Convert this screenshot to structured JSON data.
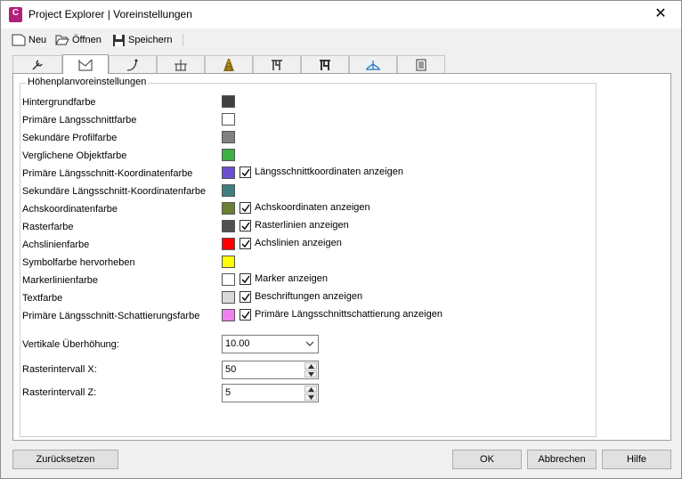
{
  "window": {
    "title": "Project Explorer | Voreinstellungen",
    "app_icon_letter": "C",
    "close_glyph": "✕"
  },
  "toolbar": {
    "new_label": "Neu",
    "open_label": "Öffnen",
    "save_label": "Speichern"
  },
  "tabs": [
    {
      "icon": "wrench-icon",
      "active": false
    },
    {
      "icon": "profile-view-icon",
      "active": true
    },
    {
      "icon": "alignment-curve-icon",
      "active": false
    },
    {
      "icon": "bridge-icon",
      "active": false
    },
    {
      "icon": "road-icon",
      "active": false
    },
    {
      "icon": "pipe-network-icon",
      "active": false
    },
    {
      "icon": "pressure-pipe-icon",
      "active": false
    },
    {
      "icon": "cross-section-icon",
      "active": false
    },
    {
      "icon": "table-icon",
      "active": false
    }
  ],
  "group": {
    "title": "Höhenplanvoreinstellungen"
  },
  "colors": [
    {
      "label": "Hintergrundfarbe",
      "color": "#404040"
    },
    {
      "label": "Primäre Längsschnittfarbe",
      "color": "#ffffff"
    },
    {
      "label": "Sekundäre Profilfarbe",
      "color": "#808080"
    },
    {
      "label": "Verglichene Objektfarbe",
      "color": "#3cb043"
    },
    {
      "label": "Primäre Längsschnitt-Koordinatenfarbe",
      "color": "#6a4fd0",
      "checkbox": "Längsschnittkoordinaten anzeigen",
      "checked": true
    },
    {
      "label": "Sekundäre Längsschnitt-Koordinatenfarbe",
      "color": "#3f7f7f"
    },
    {
      "label": "Achskoordinatenfarbe",
      "color": "#6b7f32",
      "checkbox": "Achskoordinaten anzeigen",
      "checked": true
    },
    {
      "label": "Rasterfarbe",
      "color": "#505050",
      "checkbox": "Rasterlinien anzeigen",
      "checked": true
    },
    {
      "label": "Achslinienfarbe",
      "color": "#ff0000",
      "checkbox": "Achslinien anzeigen",
      "checked": true
    },
    {
      "label": "Symbolfarbe hervorheben",
      "color": "#ffff00"
    },
    {
      "label": "Markerlinienfarbe",
      "color": "#ffffff",
      "checkbox": "Marker anzeigen",
      "checked": true
    },
    {
      "label": "Textfarbe",
      "color": "#d9d9d9",
      "checkbox": "Beschriftungen anzeigen",
      "checked": true
    },
    {
      "label": "Primäre Längsschnitt-Schattierungsfarbe",
      "color": "#ee82ee",
      "checkbox": "Primäre Längsschnittschattierung anzeigen",
      "checked": true
    }
  ],
  "fields": {
    "exaggeration": {
      "label": "Vertikale Überhöhung:",
      "value": "10.00"
    },
    "grid_x": {
      "label": "Rasterintervall X:",
      "value": "50"
    },
    "grid_z": {
      "label": "Rasterintervall Z:",
      "value": "5"
    }
  },
  "buttons": {
    "reset": "Zurücksetzen",
    "ok": "OK",
    "cancel": "Abbrechen",
    "help": "Hilfe"
  }
}
